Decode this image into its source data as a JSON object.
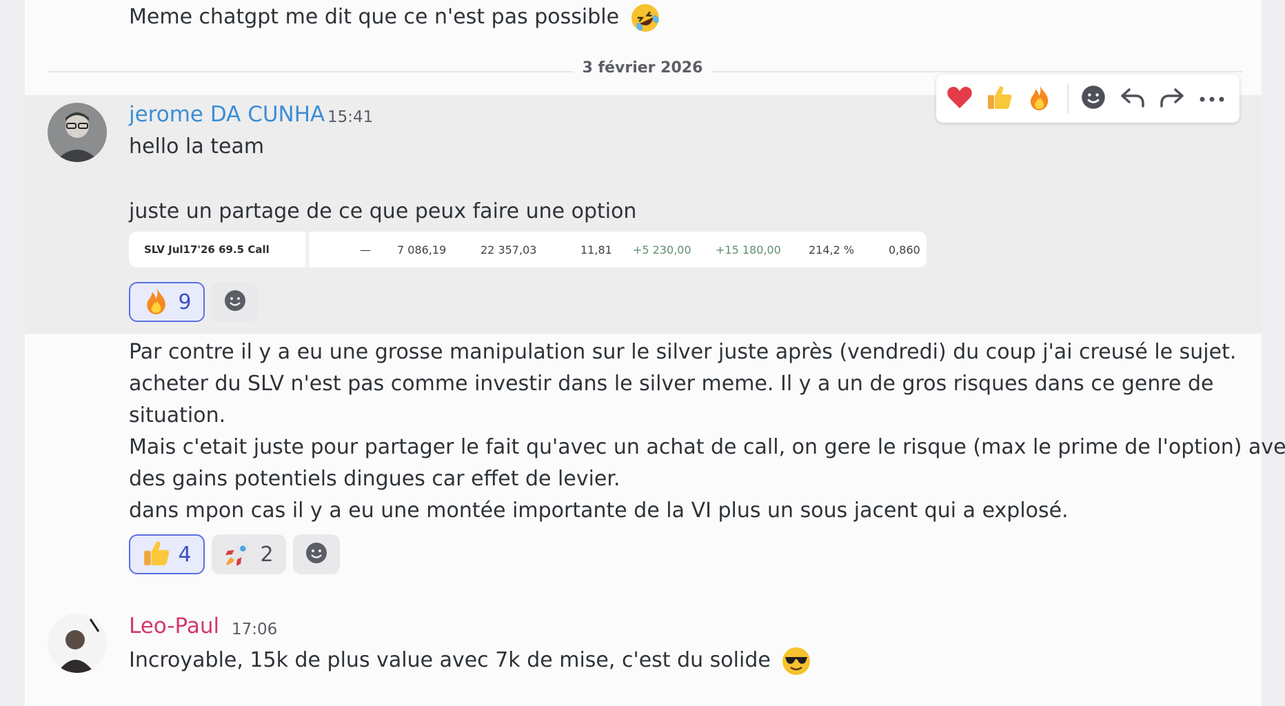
{
  "previous_message": {
    "text": "Meme chatgpt me dit que ce n'est pas possible",
    "emoji": "rolling-on-floor-laughing"
  },
  "date_divider": "3 février 2026",
  "message_1": {
    "author": "jerome DA CUNHA",
    "author_color": "#3b8ed6",
    "time": "15:41",
    "line1": "hello la team",
    "line2": "juste un partage de ce que peux faire une option",
    "embed": {
      "label": "SLV Jul17'26 69.5 Call",
      "cells": [
        "—",
        "7 086,19",
        "22 357,03",
        "11,81",
        "+5 230,00",
        "+15 180,00",
        "214,2 %",
        "0,860"
      ]
    },
    "reactions": [
      {
        "emoji": "fire",
        "count": "9",
        "me": true
      }
    ]
  },
  "message_2": {
    "lines": [
      "Par contre il y a eu une grosse manipulation sur le silver juste après (vendredi) du coup j'ai creusé le sujet.",
      "acheter du SLV n'est pas comme investir dans le silver meme. Il y a un de gros risques dans ce genre de",
      "situation.",
      "Mais c'etait juste pour partager le fait qu'avec un achat de call, on gere le risque (max le prime de l'option) avec",
      "des gains potentiels dingues car effet de levier.",
      "dans mpon cas il y a eu une montée importante de la VI plus un sous jacent qui a explosé."
    ],
    "reactions": [
      {
        "emoji": "thumbs-up",
        "count": "4",
        "me": true
      },
      {
        "emoji": "rocket",
        "count": "2",
        "me": false
      }
    ]
  },
  "message_3": {
    "author": "Leo-Paul",
    "author_color": "#d2386c",
    "time": "17:06",
    "text": "Incroyable, 15k de plus value avec 7k de mise, c'est du solide",
    "emoji": "sunglasses-face"
  },
  "toolbar": {
    "buttons": [
      "heart-reaction",
      "thumbs-up-reaction",
      "fire-reaction",
      "add-reaction",
      "reply",
      "forward",
      "more"
    ]
  },
  "colors": {
    "reaction_active_border": "#5b6ee1",
    "hover_background": "#ededee"
  }
}
